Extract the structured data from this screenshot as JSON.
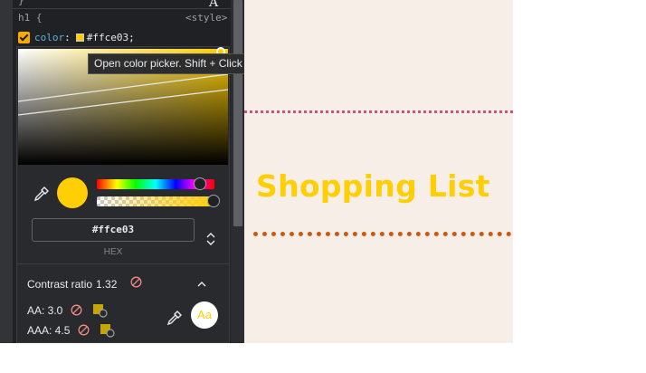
{
  "devtools": {
    "top_brace": "}",
    "selector_line": "h1 {",
    "source_link": "<style>",
    "declaration": {
      "property": "color",
      "colon": ":",
      "value": "#ffce03;"
    },
    "corner_glyph": "A"
  },
  "color_picker": {
    "hex_value": "#ffce03",
    "format_label": "HEX",
    "hue_percent": 0.88,
    "alpha_percent": 1.0,
    "contrast": {
      "title": "Contrast ratio",
      "ratio": "1.32",
      "aa_label": "AA: 3.0",
      "aaa_label": "AAA: 4.5",
      "preview_text": "Aa"
    },
    "colors": {
      "picked": "#ffce03",
      "fail_icon": "#f28b82"
    },
    "icons": [
      "eyedropper-icon",
      "format-toggle-icon",
      "no-entry-icon",
      "chevron-up-icon",
      "suggest-color-icon"
    ]
  },
  "tooltip": {
    "text": "Open color picker. Shift + Click to change color format."
  },
  "page": {
    "heading": "Shopping List",
    "colors": {
      "background": "#f8eee8",
      "heading": "#ffce03",
      "top_border": "#c9537d",
      "bottom_border": "#c95a12"
    }
  }
}
